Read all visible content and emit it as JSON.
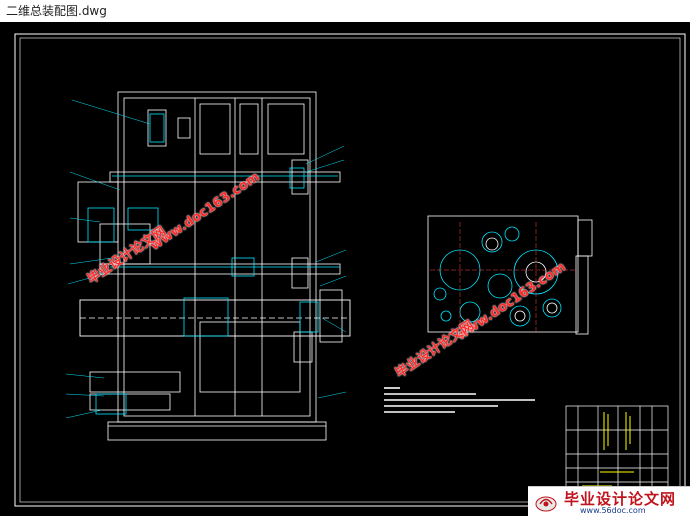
{
  "window": {
    "title": "二维总装配图.dwg"
  },
  "watermarks": {
    "site_cn": "毕业设计论文网",
    "site_url": "www.doc163.com"
  },
  "footer": {
    "title": "毕业设计论文网",
    "url": "www.56doc.com"
  },
  "colors": {
    "canvas": "#000000",
    "frame": "#ffffff",
    "drawing_lines": "#ffffff",
    "accent_cyan": "#00e5ff",
    "accent_yellow": "#ffff00",
    "watermark_red": "#ff2b2b",
    "footer_red": "#c0141c",
    "footer_blue": "#1a3a8a"
  }
}
